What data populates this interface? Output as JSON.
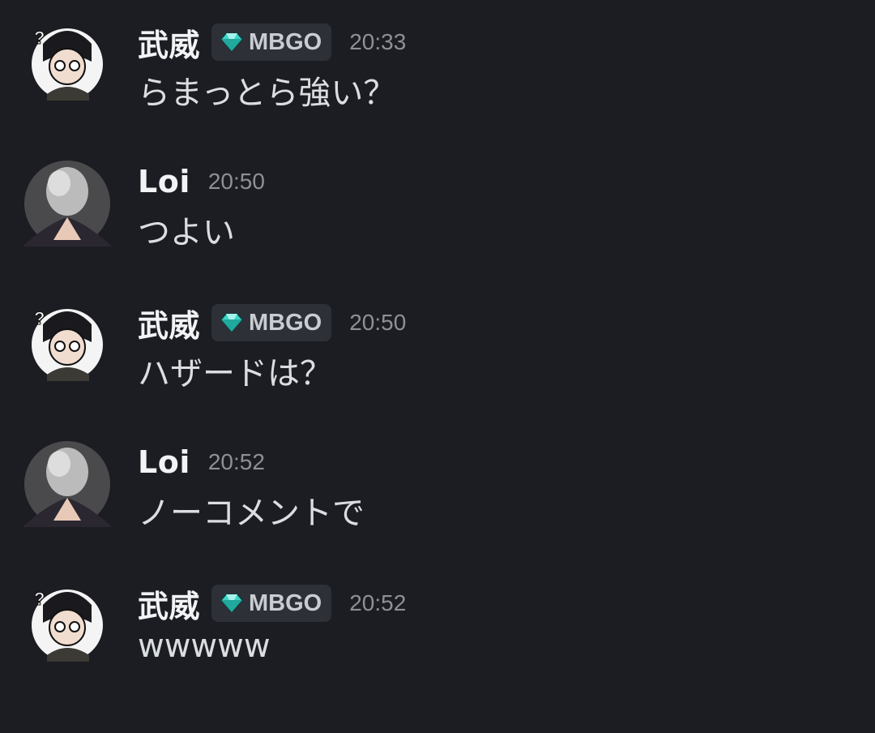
{
  "messages": [
    {
      "author": "武威",
      "tag": "MBGO",
      "time": "20:33",
      "text": "らまっとら強い？",
      "avatar": "cartoon-character-avatar"
    },
    {
      "author": "Loi",
      "time": "20:50",
      "text": "つよい",
      "avatar": "smoke-figure-avatar"
    },
    {
      "author": "武威",
      "tag": "MBGO",
      "time": "20:50",
      "text": "ハザードは？",
      "avatar": "cartoon-character-avatar"
    },
    {
      "author": "Loi",
      "time": "20:52",
      "text": "ノーコメントで",
      "avatar": "smoke-figure-avatar"
    },
    {
      "author": "武威",
      "tag": "MBGO",
      "time": "20:52",
      "text": "wwwww",
      "avatar": "cartoon-character-avatar"
    }
  ],
  "colors": {
    "background": "#1c1d22",
    "name": "#f2f3f5",
    "message_text": "#dbdee1",
    "timestamp": "#8e9098",
    "tag_background": "#2e3038",
    "gem": "#3fd4c8"
  }
}
